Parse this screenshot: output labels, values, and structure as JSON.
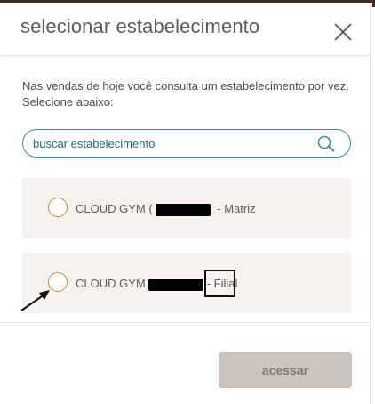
{
  "modal": {
    "title": "selecionar estabelecimento",
    "close_icon": "close-icon"
  },
  "description": "Nas vendas de hoje você consulta um estabelecimento por vez. Selecione abaixo:",
  "search": {
    "placeholder": "buscar estabelecimento",
    "value": "",
    "icon": "search-icon",
    "border_color": "#2f8f8f"
  },
  "establishments": [
    {
      "name": "CLOUD GYM (",
      "suffix": " - Matriz",
      "selected": false
    },
    {
      "name": "CLOUD GYM",
      "suffix": "- Filial",
      "selected": false
    }
  ],
  "footer": {
    "access_label": "acessar",
    "access_enabled": false
  },
  "colors": {
    "accent_radio": "#d6882b",
    "option_bg": "#f5f2ef",
    "button_disabled_bg": "#cbc4be"
  }
}
